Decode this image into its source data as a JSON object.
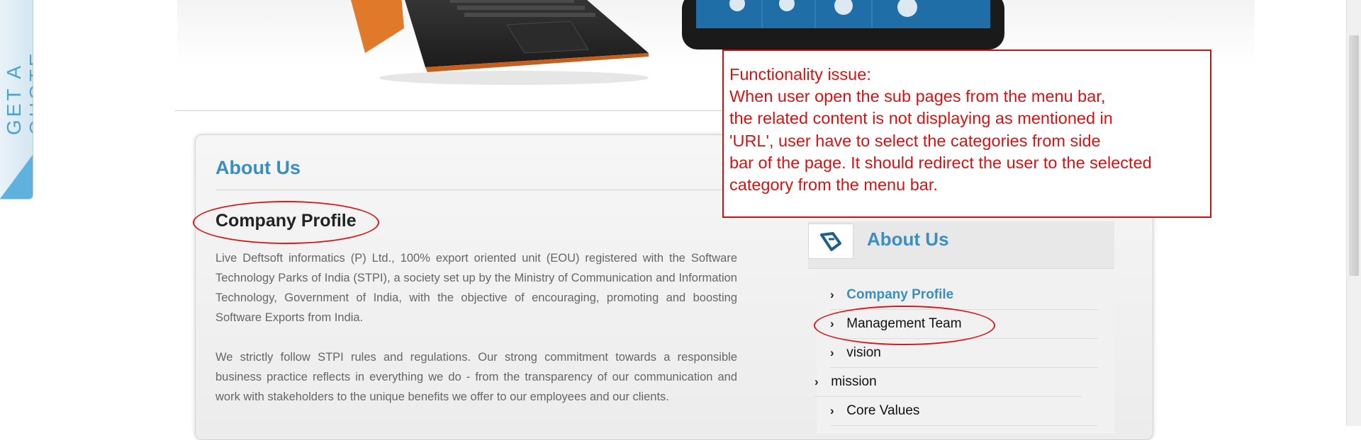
{
  "quote_tab": {
    "label": "GET A QUOTE"
  },
  "content": {
    "page_title": "About Us",
    "section_heading": "Company Profile",
    "paragraphs": [
      "Live Deftsoft informatics (P) Ltd., 100% export oriented unit (EOU) registered with the Software Technology Parks of India (STPI), a society set up by the Ministry of Communication and Information Technology, Government of India, with the objective of encouraging, promoting and boosting Software Exports from India.",
      "We strictly follow STPI rules and regulations. Our strong commitment towards a responsible business practice reflects in everything we do - from the transparency of our communication and work with stakeholders to the unique benefits we offer to our employees and our clients."
    ]
  },
  "sidebar": {
    "title": "About Us",
    "items": [
      {
        "label": "Company Profile",
        "active": true
      },
      {
        "label": "Management Team",
        "active": false
      },
      {
        "label": "vision",
        "active": false
      },
      {
        "label": "mission",
        "active": false
      },
      {
        "label": "Core Values",
        "active": false
      }
    ]
  },
  "annotation": {
    "lines": [
      "Functionality issue:",
      "When user open the sub pages from the menu bar,",
      "the related content is not displaying as mentioned in",
      "'URL', user have to select the categories from side",
      "bar of the page. It should redirect the user to the selected",
      "category from the menu bar."
    ],
    "color": "#d41414"
  },
  "colors": {
    "accent": "#3a8fc0",
    "annotation_red": "#cc1111",
    "body_text": "#666666"
  }
}
